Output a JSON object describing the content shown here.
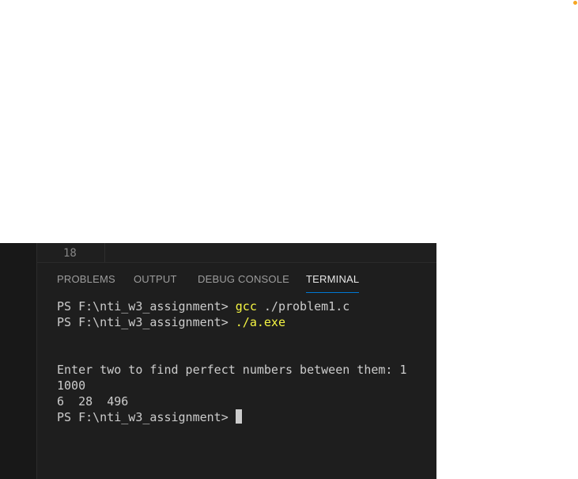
{
  "editor": {
    "line_number": "18"
  },
  "panel": {
    "tabs": [
      {
        "label": "PROBLEMS"
      },
      {
        "label": "OUTPUT"
      },
      {
        "label": "DEBUG CONSOLE"
      },
      {
        "label": "TERMINAL",
        "active": true
      }
    ]
  },
  "terminal": {
    "prompt": "PS F:\\nti_w3_assignment> ",
    "cmd1": "gcc",
    "cmd1_args": " ./problem1.c",
    "cmd2": "./a.exe",
    "output_line1": "Enter two to find perfect numbers between them: 1",
    "output_line2": "1000",
    "output_line3": "6  28  496"
  },
  "colors": {
    "accent": "#0078d4",
    "command": "#f5f543",
    "notification_dot": "#f5a623"
  }
}
